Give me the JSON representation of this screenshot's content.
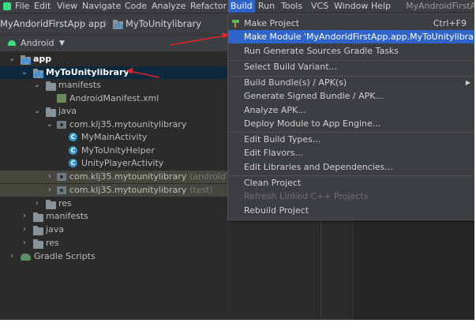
{
  "menubar": {
    "items": [
      {
        "label": "File"
      },
      {
        "label": "Edit"
      },
      {
        "label": "View"
      },
      {
        "label": "Navigate"
      },
      {
        "label": "Code"
      },
      {
        "label": "Analyze"
      },
      {
        "label": "Refactor"
      },
      {
        "label": "Build"
      },
      {
        "label": "Run"
      },
      {
        "label": "Tools"
      },
      {
        "label": "VCS"
      },
      {
        "label": "Window"
      },
      {
        "label": "Help"
      }
    ],
    "window_title": "MyAndroidFirstApp"
  },
  "breadcrumb": {
    "project": "MyAndoridFirstApp",
    "module": "app",
    "library": "MyToUnitylibrary"
  },
  "project_view": {
    "selector_label": "Android"
  },
  "tree": {
    "app": "app",
    "mytounitylibrary": "MyToUnitylibrary",
    "manifests_1": "manifests",
    "android_manifest": "AndroidManifest.xml",
    "java_1": "java",
    "package_main": "com.klj35.mytounitylibrary",
    "class_main_activity": "MyMainActivity",
    "class_helper": "MyToUnityHelper",
    "class_player_activity": "UnityPlayerActivity",
    "package_android_test": "com.klj35.mytounitylibrary",
    "package_android_test_suffix": "(androidTest)",
    "package_test": "com.klj35.mytounitylibrary",
    "package_test_suffix": "(test)",
    "res_1": "res",
    "manifests_2": "manifests",
    "java_2": "java",
    "res_2": "res",
    "gradle_scripts": "Gradle Scripts"
  },
  "build_menu": {
    "make_project": "Make Project",
    "make_project_shortcut": "Ctrl+F9",
    "make_module": "Make Module 'MyAndoridFirstApp.app.MyToUnitylibrary'",
    "run_generate": "Run Generate Sources Gradle Tasks",
    "select_variant": "Select Build Variant...",
    "build_bundles": "Build Bundle(s) / APK(s)",
    "generate_signed": "Generate Signed Bundle / APK...",
    "analyze_apk": "Analyze APK...",
    "deploy_module": "Deploy Module to App Engine...",
    "edit_build_types": "Edit Build Types...",
    "edit_flavors": "Edit Flavors...",
    "edit_libraries": "Edit Libraries and Dependencies...",
    "clean_project": "Clean Project",
    "refresh_linked": "Refresh Linked C++ Projects",
    "rebuild_project": "Rebuild Project"
  },
  "colors": {
    "menu_highlight": "#2f65ca",
    "annotation_arrow": "#e0242a"
  }
}
